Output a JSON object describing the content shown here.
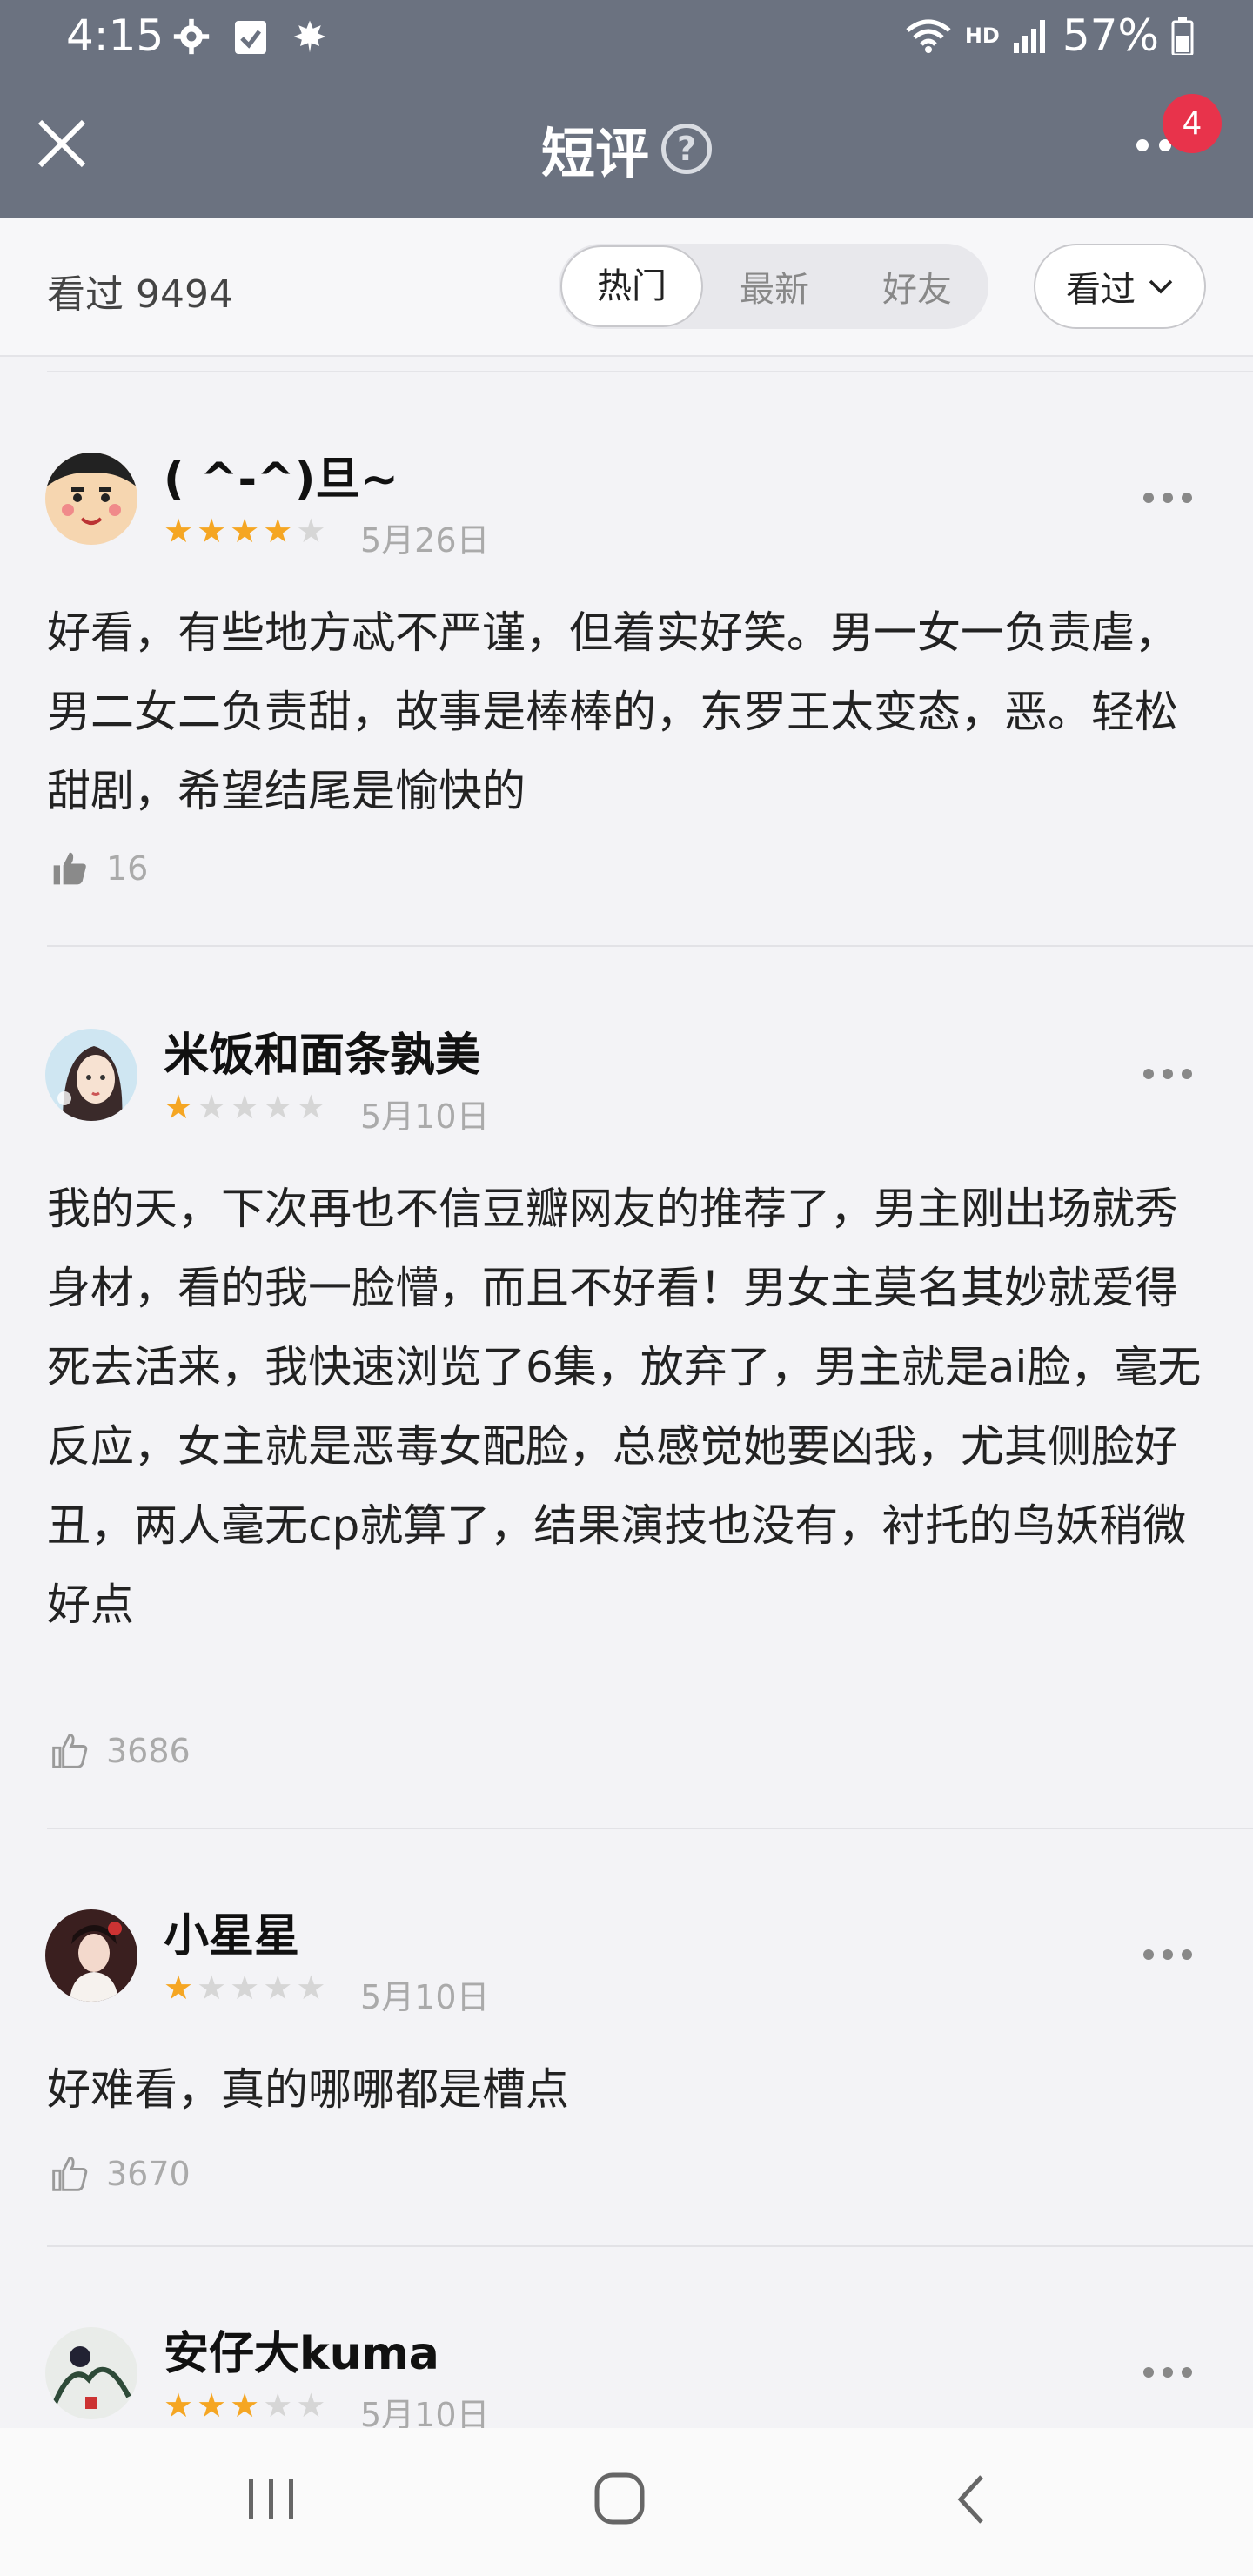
{
  "status_bar": {
    "time": "4:15",
    "hd": "HD",
    "battery": "57%",
    "icons": [
      "settings-icon",
      "calendar-check-icon",
      "maple-leaf-icon",
      "wifi-icon",
      "signal-icon",
      "battery-icon"
    ]
  },
  "header": {
    "title": "短评",
    "help": "?",
    "notification_count": "4"
  },
  "filter": {
    "watched_label": "看过 9494",
    "tabs": [
      {
        "label": "热门",
        "active": true
      },
      {
        "label": "最新"
      },
      {
        "label": "好友"
      }
    ],
    "dropdown_label": "看过"
  },
  "comments": [
    {
      "name": "( ^-^)旦~",
      "rating": 4,
      "date": "5月26日",
      "text": "好看，有些地方忒不严谨，但着实好笑。男一女一负责虐，男二女二负责甜，故事是棒棒的，东罗王太变态，恶。轻松甜剧，希望结尾是愉快的",
      "likes": "16"
    },
    {
      "name": "米饭和面条孰美",
      "rating": 1,
      "date": "5月10日",
      "text": "我的天，下次再也不信豆瓣网友的推荐了，男主刚出场就秀身材，看的我一脸懵，而且不好看！男女主莫名其妙就爱得死去活来，我快速浏览了6集，放弃了，男主就是ai脸，毫无反应，女主就是恶毒女配脸，总感觉她要凶我，尤其侧脸好丑，两人毫无cp就算了，结果演技也没有，衬托的鸟妖稍微好点",
      "likes": "3686"
    },
    {
      "name": "小星星",
      "rating": 1,
      "date": "5月10日",
      "text": "好难看，真的哪哪都是槽点",
      "likes": "3670"
    },
    {
      "name": "安仔大kuma",
      "rating": 3,
      "date": "5月10日",
      "text": "",
      "likes": ""
    }
  ],
  "colors": {
    "header_bg": "#6b7280",
    "badge": "#e8334b",
    "star_on": "#f5a623",
    "star_off": "#d6d6d6"
  }
}
